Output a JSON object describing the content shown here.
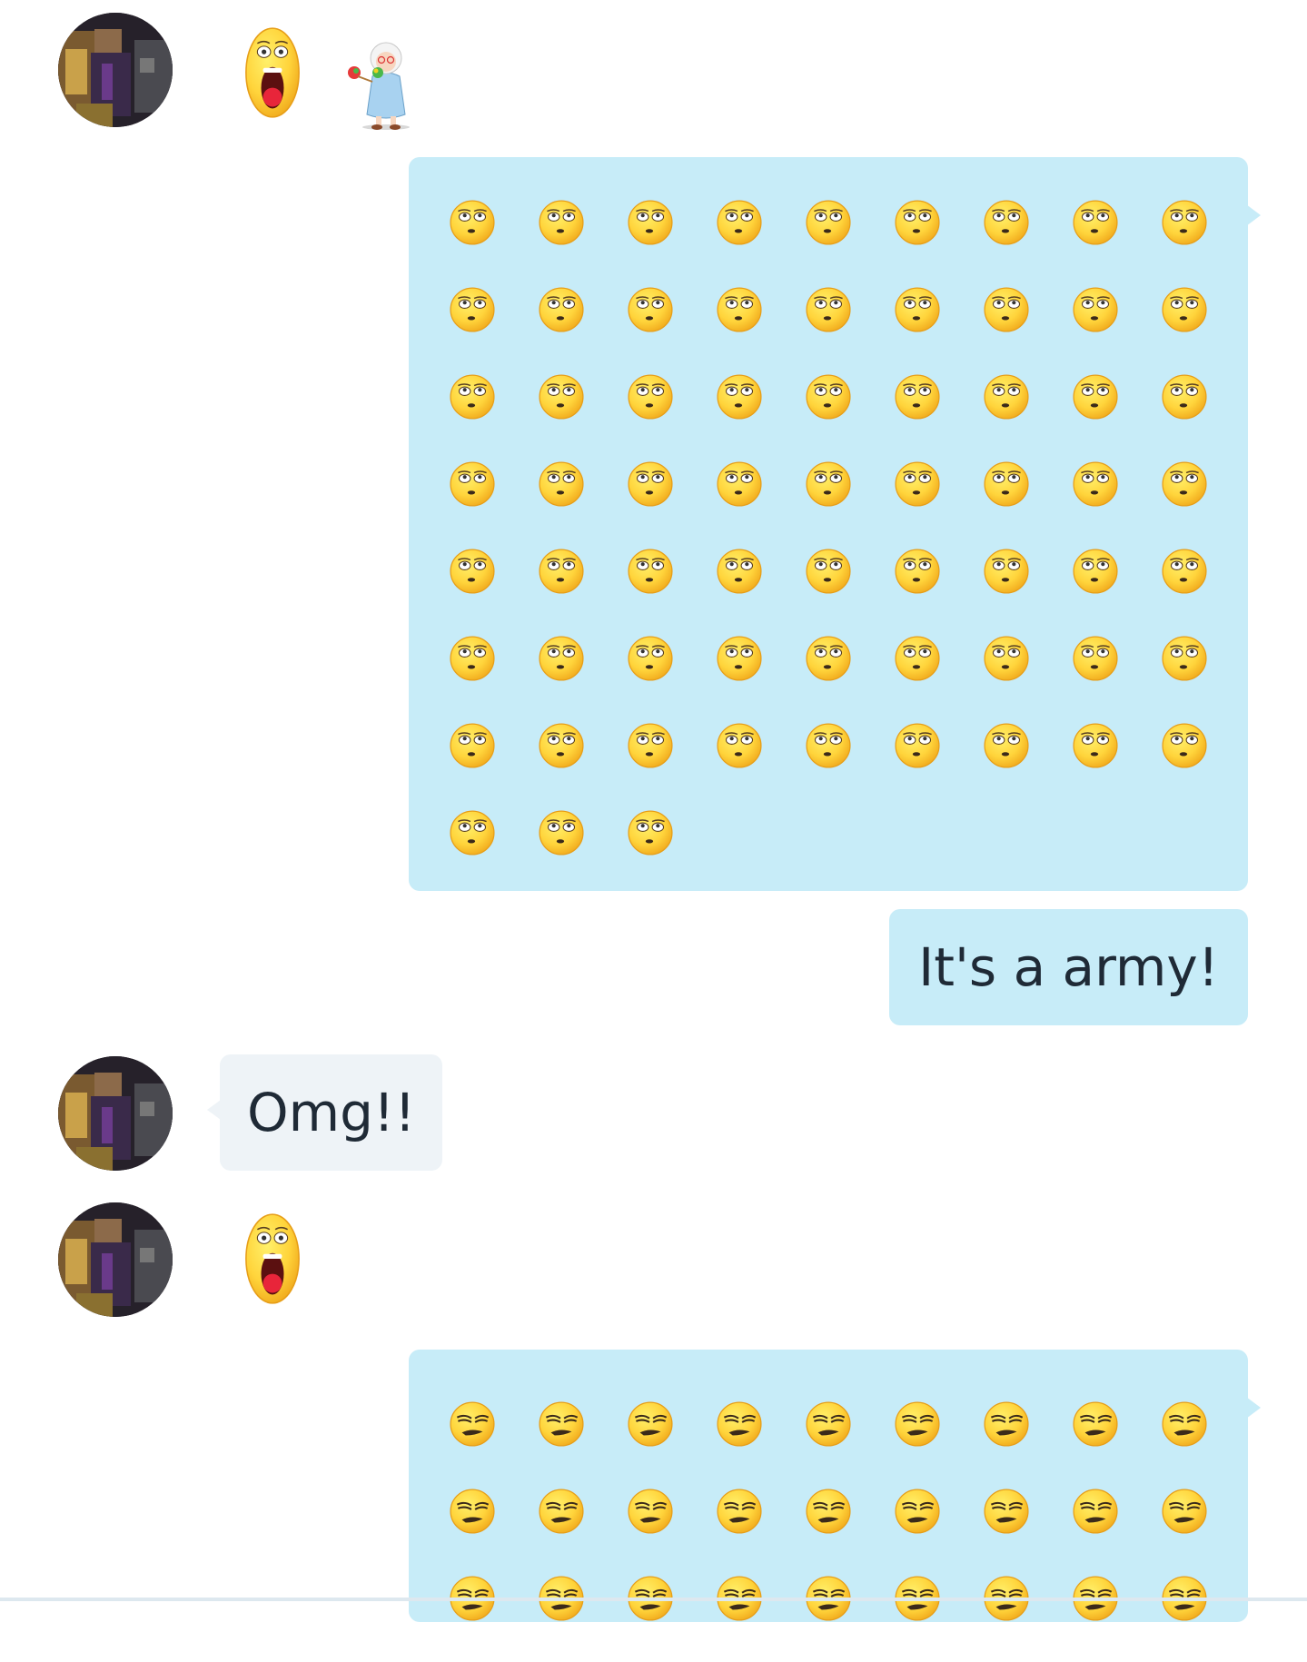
{
  "colors": {
    "outgoing_bubble": "#c7ecf8",
    "incoming_bubble": "#eef3f7",
    "text": "#1f2a36",
    "emoticon_yellow": "#ffd43b"
  },
  "messages": [
    {
      "direction": "incoming",
      "type": "emoticons",
      "emoticons": [
        "surprised-emoticon",
        "grandma-maracas-emoticon"
      ]
    },
    {
      "direction": "outgoing",
      "type": "emoticon-grid",
      "emoticon": "rolling-eyes-emoticon",
      "count": 66,
      "columns": 9
    },
    {
      "direction": "outgoing",
      "type": "text",
      "text": "It's a army!"
    },
    {
      "direction": "incoming",
      "type": "text",
      "text": "Omg!!"
    },
    {
      "direction": "incoming",
      "type": "emoticons",
      "emoticons": [
        "surprised-emoticon"
      ]
    },
    {
      "direction": "outgoing",
      "type": "emoticon-grid",
      "emoticon": "smirk-emoticon",
      "visible_rows": 3,
      "columns": 9,
      "truncated": true
    }
  ]
}
